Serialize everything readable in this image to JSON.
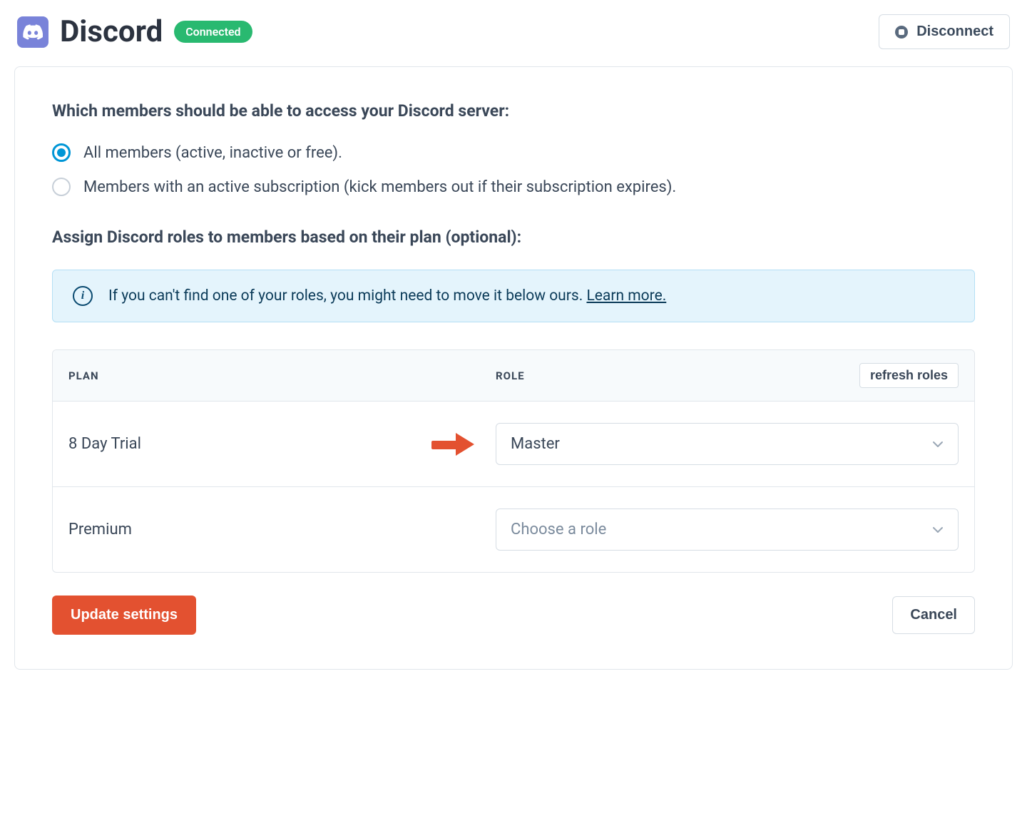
{
  "header": {
    "title": "Discord",
    "badge": "Connected",
    "disconnect_label": "Disconnect"
  },
  "access_section": {
    "heading": "Which members should be able to access your Discord server:",
    "options": [
      {
        "label": "All members (active, inactive or free).",
        "selected": true
      },
      {
        "label": "Members with an active subscription (kick members out if their subscription expires).",
        "selected": false
      }
    ]
  },
  "roles_section": {
    "heading": "Assign Discord roles to members based on their plan (optional):",
    "info_text": "If you can't find one of your roles, you might need to move it below ours. ",
    "info_link": "Learn more.",
    "table": {
      "plan_header": "PLAN",
      "role_header": "ROLE",
      "refresh_label": "refresh roles",
      "rows": [
        {
          "plan": "8 Day Trial",
          "role": "Master",
          "placeholder": false,
          "annotated": true
        },
        {
          "plan": "Premium",
          "role": "Choose a role",
          "placeholder": true,
          "annotated": false
        }
      ]
    }
  },
  "footer": {
    "update_label": "Update settings",
    "cancel_label": "Cancel"
  }
}
